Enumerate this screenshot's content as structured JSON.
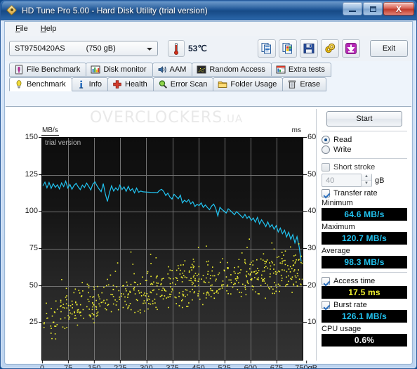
{
  "window": {
    "title": "HD Tune Pro 5.00 - Hard Disk Utility (trial version)",
    "app_icon": "diamond-icon",
    "minimize_label": "Minimize",
    "maximize_label": "Maximize",
    "close_label": "X"
  },
  "menu": {
    "items": [
      {
        "label": "File",
        "mnemonic": "F",
        "rest": "ile"
      },
      {
        "label": "Help",
        "mnemonic": "H",
        "rest": "elp"
      }
    ]
  },
  "toolbar": {
    "drive": {
      "name": "ST9750420AS",
      "capacity": "(750 gB)"
    },
    "temperature": "53℃",
    "temperature_icon": "thermometer-icon",
    "icons": [
      {
        "name": "copy-text-icon",
        "label": "Copy to clipboard"
      },
      {
        "name": "copy-image-icon",
        "label": "Copy screenshot"
      },
      {
        "name": "save-icon",
        "label": "Save"
      },
      {
        "name": "gear-icon",
        "label": "Options"
      },
      {
        "name": "download-icon",
        "label": "Update"
      }
    ],
    "exit_label": "Exit"
  },
  "tabs": {
    "row1": [
      {
        "label": "File Benchmark",
        "icon": "file-benchmark-icon",
        "active": false
      },
      {
        "label": "Disk monitor",
        "icon": "bar-chart-icon",
        "active": false
      },
      {
        "label": "AAM",
        "icon": "speaker-icon",
        "active": false
      },
      {
        "label": "Random Access",
        "icon": "scatter-icon",
        "active": false
      },
      {
        "label": "Extra tests",
        "icon": "extra-tests-icon",
        "active": false
      }
    ],
    "row2": [
      {
        "label": "Benchmark",
        "icon": "bulb-icon",
        "active": true
      },
      {
        "label": "Info",
        "icon": "info-icon",
        "active": false
      },
      {
        "label": "Health",
        "icon": "cross-icon",
        "active": false
      },
      {
        "label": "Error Scan",
        "icon": "magnifier-icon",
        "active": false
      },
      {
        "label": "Folder Usage",
        "icon": "folder-icon",
        "active": false
      },
      {
        "label": "Erase",
        "icon": "trash-icon",
        "active": false
      }
    ]
  },
  "content": {
    "watermark_main": "OVERCLOCKERS",
    "watermark_suffix": ".UA",
    "trial_label": "trial version"
  },
  "panel": {
    "start_label": "Start",
    "read_label": "Read",
    "write_label": "Write",
    "read_selected": true,
    "short_stroke_label": "Short stroke",
    "short_stroke_checked": false,
    "short_stroke_value": "40",
    "short_stroke_unit": "gB",
    "transfer_rate_label": "Transfer rate",
    "transfer_rate_checked": true,
    "minimum_label": "Minimum",
    "minimum_value": "64.6 MB/s",
    "maximum_label": "Maximum",
    "maximum_value": "120.7 MB/s",
    "average_label": "Average",
    "average_value": "98.3 MB/s",
    "access_time_label": "Access time",
    "access_time_checked": true,
    "access_time_value": "17.5 ms",
    "burst_rate_label": "Burst rate",
    "burst_rate_checked": true,
    "burst_rate_value": "126.1 MB/s",
    "cpu_usage_label": "CPU usage",
    "cpu_usage_value": "0.6%",
    "colors": {
      "transfer_rate": "#21c3f0",
      "access_time": "#f4f430",
      "cpu_usage": "#f2f2f2",
      "lcd_background": "#000000"
    }
  },
  "chart_data": {
    "type": "line",
    "title": "",
    "xlabel": "",
    "ylabel": "MB/s",
    "y2label": "ms",
    "grid": true,
    "legend_position": "none",
    "xlim": [
      0,
      750
    ],
    "ylim": [
      0,
      150
    ],
    "y2lim": [
      0,
      60
    ],
    "xticks": [
      0,
      75,
      150,
      225,
      300,
      375,
      450,
      525,
      600,
      675,
      750
    ],
    "xtick_labels": [
      "0",
      "75",
      "150",
      "225",
      "300",
      "375",
      "450",
      "525",
      "600",
      "675",
      "750gB"
    ],
    "yticks": [
      25,
      50,
      75,
      100,
      125,
      150
    ],
    "ytick_labels": [
      "25",
      "50",
      "75",
      "100",
      "125",
      "150"
    ],
    "y2ticks": [
      10,
      20,
      30,
      40,
      50,
      60
    ],
    "y2tick_labels": [
      "10",
      "20",
      "30",
      "40",
      "50",
      "60"
    ],
    "series": [
      {
        "name": "Transfer rate",
        "color": "#21c3f0",
        "axis": "left",
        "unit": "MB/s",
        "x": [
          2,
          8,
          14,
          20,
          26,
          32,
          38,
          44,
          50,
          56,
          62,
          68,
          74,
          80,
          86,
          92,
          98,
          104,
          110,
          116,
          122,
          128,
          134,
          140,
          146,
          152,
          158,
          164,
          170,
          176,
          182,
          188,
          194,
          200,
          206,
          212,
          218,
          224,
          230,
          236,
          242,
          248,
          254,
          260,
          266,
          272,
          278,
          284,
          290,
          296,
          302,
          308,
          314,
          320,
          326,
          332,
          338,
          344,
          350,
          356,
          362,
          368,
          374,
          380,
          386,
          392,
          398,
          404,
          410,
          416,
          422,
          428,
          434,
          440,
          446,
          452,
          458,
          464,
          470,
          476,
          482,
          488,
          494,
          500,
          506,
          512,
          518,
          524,
          530,
          536,
          542,
          548,
          554,
          560,
          566,
          572,
          578,
          584,
          590,
          596,
          602,
          608,
          614,
          620,
          626,
          632,
          638,
          644,
          650,
          656,
          662,
          668,
          674,
          680,
          686,
          692,
          698,
          704,
          710,
          716,
          722,
          728,
          734,
          740,
          746
        ],
        "y": [
          117.5,
          120.0,
          116.2,
          119.8,
          115.8,
          119.0,
          116.5,
          118.2,
          115.5,
          119.5,
          117.0,
          120.7,
          116.0,
          118.5,
          115.2,
          117.8,
          119.2,
          116.8,
          115.0,
          118.0,
          116.4,
          119.4,
          117.2,
          114.8,
          118.6,
          120.2,
          117.6,
          115.4,
          113.6,
          119.0,
          112.2,
          107.0,
          113.0,
          117.6,
          114.0,
          116.2,
          114.6,
          118.0,
          115.0,
          116.8,
          113.8,
          117.2,
          114.2,
          115.6,
          112.8,
          116.0,
          113.2,
          114.0,
          113.5,
          113.4,
          113.3,
          113.2,
          113.1,
          113.0,
          113.0,
          112.9,
          114.5,
          115.2,
          113.8,
          111.0,
          112.6,
          110.0,
          108.6,
          111.8,
          110.4,
          108.8,
          111.2,
          106.0,
          107.8,
          106.6,
          108.2,
          105.4,
          106.8,
          103.6,
          105.0,
          104.2,
          106.0,
          103.0,
          104.6,
          102.8,
          101.4,
          103.8,
          105.2,
          102.4,
          97.2,
          103.0,
          101.6,
          100.4,
          99.2,
          102.0,
          100.8,
          99.4,
          98.0,
          100.2,
          98.8,
          97.4,
          96.0,
          98.2,
          95.6,
          97.0,
          94.2,
          95.8,
          93.0,
          96.2,
          91.8,
          94.6,
          92.4,
          90.0,
          93.2,
          89.6,
          91.4,
          88.2,
          90.6,
          86.4,
          89.0,
          85.2,
          87.6,
          83.0,
          86.2,
          81.4,
          84.6,
          79.0,
          83.2,
          76.4,
          66.5
        ],
        "minimum": 64.6,
        "maximum": 120.7,
        "average": 98.3
      },
      {
        "name": "Access time",
        "color": "#f4f430",
        "axis": "right",
        "unit": "ms",
        "marker": "dot",
        "average": 17.5,
        "description": "Scattered dot cloud rising from ~7 ms near 0 gB to ~26 ms near 750 gB",
        "trend_x": [
          0,
          75,
          150,
          225,
          300,
          375,
          450,
          525,
          600,
          675,
          750
        ],
        "trend_y": [
          9.0,
          13.5,
          15.5,
          17.0,
          18.5,
          19.5,
          20.5,
          21.5,
          22.5,
          23.5,
          24.5
        ],
        "spread_ms": 5.5
      }
    ]
  }
}
